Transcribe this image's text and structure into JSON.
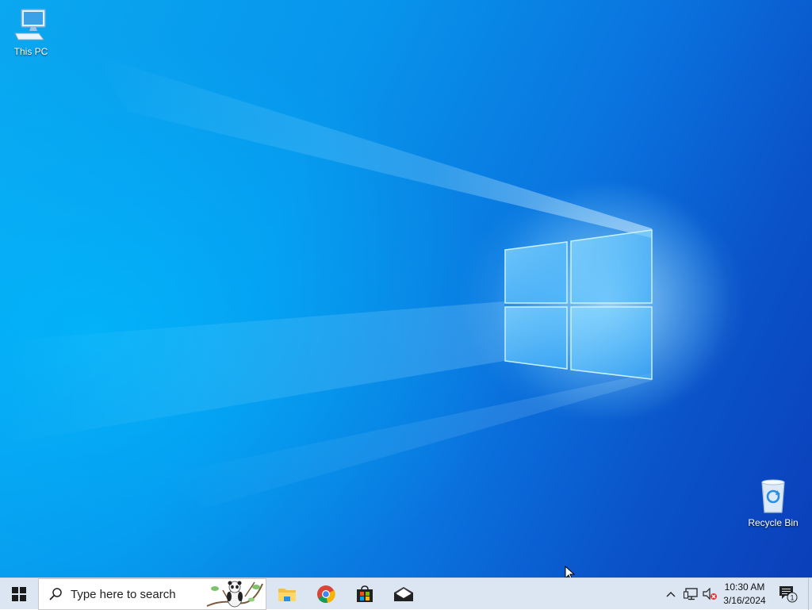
{
  "desktop": {
    "icons": [
      {
        "label": "This PC",
        "icon": "computer-icon"
      },
      {
        "label": "Recycle Bin",
        "icon": "recycle-bin-icon"
      }
    ],
    "wallpaper": "windows-logo-light-beam",
    "colors": {
      "accent": "#0a78e0",
      "light": "#7fd4ff"
    }
  },
  "taskbar": {
    "start_icon": "windows-start-icon",
    "search": {
      "placeholder": "Type here to search",
      "icon": "search-icon"
    },
    "pinned": [
      {
        "name": "File Explorer",
        "icon": "folder-icon"
      },
      {
        "name": "Google Chrome",
        "icon": "chrome-icon"
      },
      {
        "name": "Microsoft Store",
        "icon": "store-icon"
      },
      {
        "name": "Mail",
        "icon": "mail-icon"
      }
    ],
    "tray": {
      "icons": [
        "chevron-up-icon",
        "network-icon",
        "volume-muted-icon"
      ],
      "time": "10:30 AM",
      "date": "3/16/2024",
      "notifications_count": "1"
    }
  }
}
